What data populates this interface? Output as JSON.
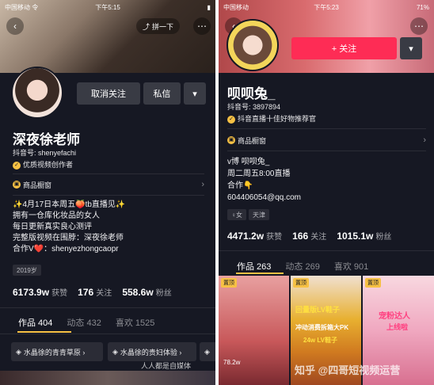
{
  "left": {
    "status_carrier": "中国移动 令",
    "status_time": "下午5:15",
    "share_label": "拼一下",
    "follow_button": "取消关注",
    "message_button": "私信",
    "more_button": "▾",
    "name": "深夜徐老师",
    "douyin_id": "抖音号: shenyefachi",
    "verification": "优质视频创作者",
    "shop_window": "商品橱窗",
    "bio": [
      "✨4月17日本周五🍑tb直播见✨",
      "拥有一仓库化妆品的女人",
      "每日更新真实良心测评",
      "完整版视频在围脖：深夜徐老师",
      "合作V❤️：shenyezhongcaopr"
    ],
    "age_tag": "2019岁",
    "stats": [
      {
        "value": "6173.9w",
        "label": "获赞"
      },
      {
        "value": "176",
        "label": "关注"
      },
      {
        "value": "558.6w",
        "label": "粉丝"
      }
    ],
    "tabs": [
      {
        "label": "作品 404",
        "active": true
      },
      {
        "label": "动态 432",
        "active": false
      },
      {
        "label": "喜欢 1525",
        "active": false
      }
    ],
    "collections": [
      "水晶徐的青青草原 ›",
      "水晶徐的贵妇体验 ›"
    ],
    "watermark": "人人都是自媒体"
  },
  "right": {
    "status_carrier": "中国移动",
    "status_time": "下午5:23",
    "status_battery": "71%",
    "follow_button": "+ 关注",
    "more_button": "▾",
    "name": "呗呗兔_",
    "douyin_id": "抖音号: 3897894",
    "verification": "抖音直播十佳好物推荐官",
    "shop_window": "商品橱窗",
    "bio": [
      "v博 呗呗兔_",
      "周二周五8:00直播",
      "合作👇",
      "604406054@qq.com"
    ],
    "tags": [
      "♀女",
      "天津"
    ],
    "stats": [
      {
        "value": "4471.2w",
        "label": "获赞"
      },
      {
        "value": "166",
        "label": "关注"
      },
      {
        "value": "1015.1w",
        "label": "粉丝"
      }
    ],
    "tabs": [
      {
        "label": "作品 263",
        "active": true
      },
      {
        "label": "动态 269",
        "active": false
      },
      {
        "label": "喜欢 901",
        "active": false
      }
    ],
    "thumbs": [
      {
        "pin": "置顶",
        "text": "",
        "likes": "78.2w"
      },
      {
        "pin": "置顶",
        "text": "回量版LV鞋子",
        "likes": ""
      },
      {
        "pin": "置顶",
        "text": "宠粉达人",
        "likes": ""
      }
    ],
    "thumb_overlay_1": "冲动消费拆箱大PK",
    "thumb_overlay_2": "24w LV鞋子",
    "thumb_overlay_3": "上线啦",
    "watermark": "知乎 @四哥短视频运营"
  },
  "colors": {
    "bg": "#161823",
    "accent_red": "#fe2c55",
    "accent_yellow": "#f7c144"
  }
}
